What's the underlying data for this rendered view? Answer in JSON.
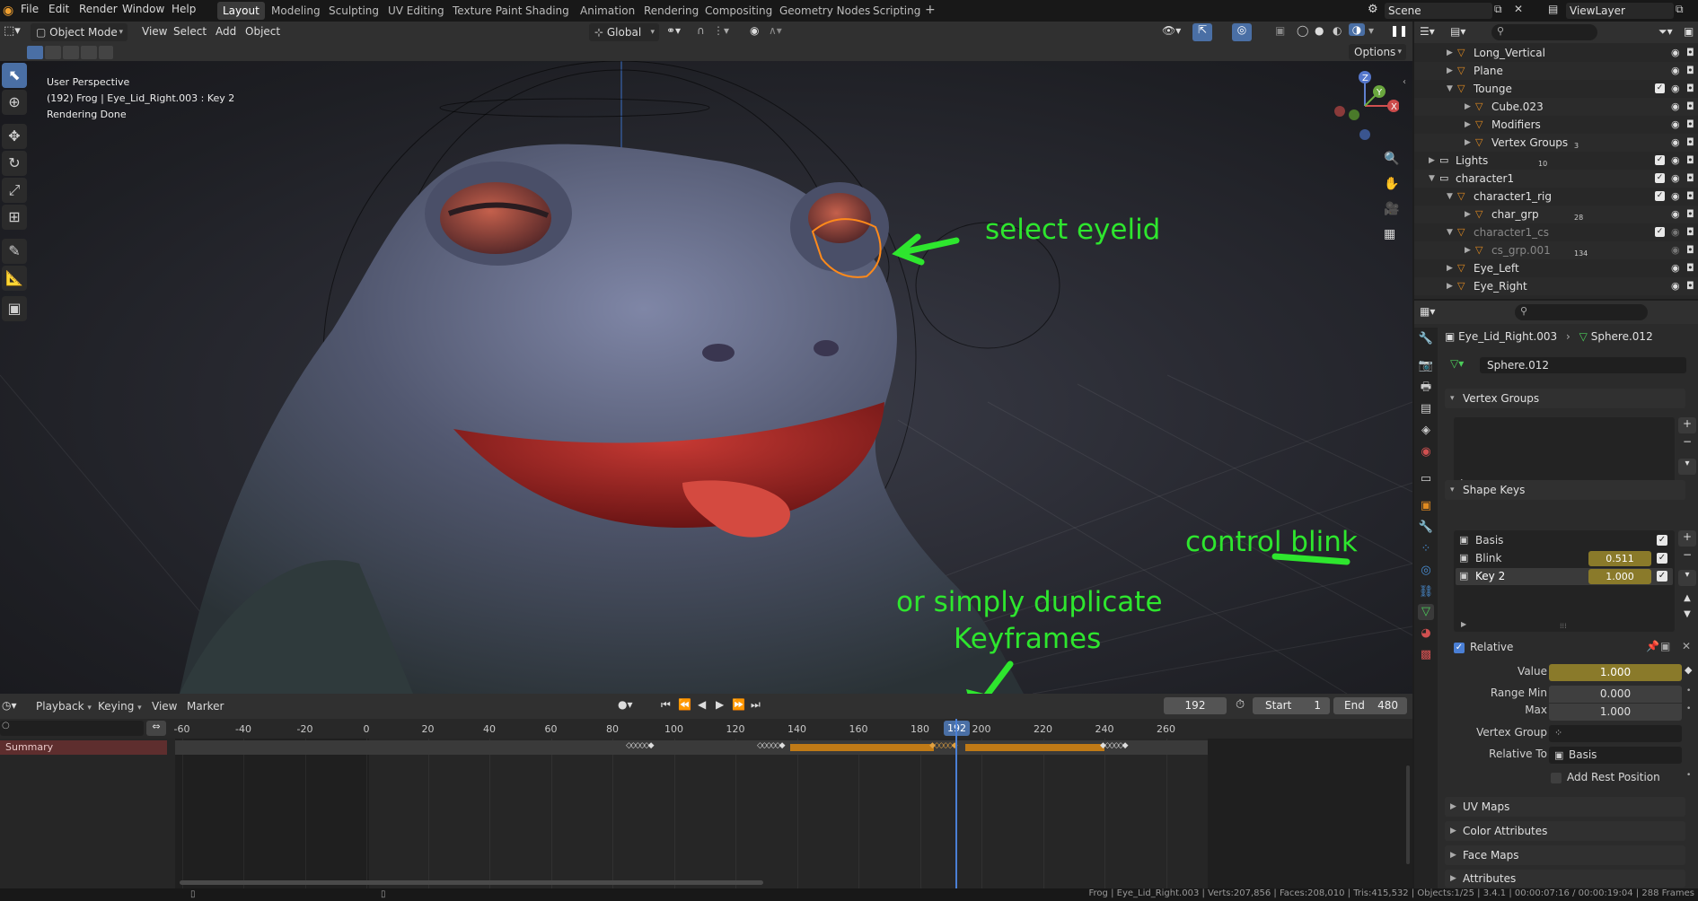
{
  "app": {
    "menus": [
      "File",
      "Edit",
      "Render",
      "Window",
      "Help"
    ],
    "workspaces": [
      "Layout",
      "Modeling",
      "Sculpting",
      "UV Editing",
      "Texture Paint",
      "Shading",
      "Animation",
      "Rendering",
      "Compositing",
      "Geometry Nodes",
      "Scripting"
    ],
    "active_workspace": "Layout",
    "scene": "Scene",
    "view_layer": "ViewLayer"
  },
  "viewport_header": {
    "mode": "Object Mode",
    "menus": [
      "View",
      "Select",
      "Add",
      "Object"
    ],
    "orientation": "Global",
    "options": "Options"
  },
  "viewport": {
    "perspective": "User Perspective",
    "object_info": "(192) Frog | Eye_Lid_Right.003 : Key 2",
    "status": "Rendering Done",
    "gizmo_axes": [
      "Z",
      "Y",
      "X"
    ]
  },
  "annotations": {
    "select_eyelid": "select eyelid",
    "control_blink": "control blink",
    "duplicate_line1": "or simply duplicate",
    "duplicate_line2": "Keyframes"
  },
  "timeline": {
    "menus": [
      "Playback",
      "Keying",
      "View",
      "Marker"
    ],
    "current_frame": "192",
    "start_label": "Start",
    "start": "1",
    "end_label": "End",
    "end": "480",
    "ticks": [
      "-60",
      "-40",
      "-20",
      "0",
      "20",
      "40",
      "60",
      "80",
      "100",
      "120",
      "140",
      "160",
      "180",
      "200",
      "220",
      "240",
      "260"
    ],
    "summary": "Summary"
  },
  "status_bar": {
    "text": "Frog | Eye_Lid_Right.003 | Verts:207,856 | Faces:208,010 | Tris:415,532 | Objects:1/25 | 3.4.1 | 00:00:07:16 / 00:00:19:04 | 288 Frames"
  },
  "outliner": {
    "rows": [
      {
        "label": "Long_Vertical",
        "indent": 1,
        "expanded": false
      },
      {
        "label": "Plane",
        "indent": 1,
        "expanded": false
      },
      {
        "label": "Tounge",
        "indent": 1,
        "expanded": true
      },
      {
        "label": "Cube.023",
        "indent": 2,
        "expanded": false
      },
      {
        "label": "Modifiers",
        "indent": 2,
        "expanded": false
      },
      {
        "label": "Vertex Groups",
        "indent": 2,
        "expanded": false,
        "badge": "3"
      },
      {
        "label": "Lights",
        "indent": 0,
        "expanded": false,
        "badge": "10"
      },
      {
        "label": "character1",
        "indent": 0,
        "expanded": true
      },
      {
        "label": "character1_rig",
        "indent": 1,
        "expanded": true
      },
      {
        "label": "char_grp",
        "indent": 2,
        "expanded": false,
        "badge": "28"
      },
      {
        "label": "character1_cs",
        "indent": 1,
        "expanded": true,
        "dim": true
      },
      {
        "label": "cs_grp.001",
        "indent": 2,
        "expanded": false,
        "dim": true,
        "badge": "134"
      },
      {
        "label": "Eye_Left",
        "indent": 1,
        "expanded": false
      },
      {
        "label": "Eye_Right",
        "indent": 1,
        "expanded": false
      }
    ]
  },
  "properties": {
    "breadcrumb_object": "Eye_Lid_Right.003",
    "breadcrumb_data": "Sphere.012",
    "mesh_name": "Sphere.012",
    "vertex_groups_title": "Vertex Groups",
    "shape_keys_title": "Shape Keys",
    "shape_keys": [
      {
        "name": "Basis",
        "value": ""
      },
      {
        "name": "Blink",
        "value": "0.511"
      },
      {
        "name": "Key 2",
        "value": "1.000"
      }
    ],
    "relative_label": "Relative",
    "value_label": "Value",
    "value": "1.000",
    "range_min_label": "Range Min",
    "range_min": "0.000",
    "max_label": "Max",
    "max": "1.000",
    "vertex_group_label": "Vertex Group",
    "relative_to_label": "Relative To",
    "relative_to": "Basis",
    "add_rest_label": "Add Rest Position",
    "collapsed_panels": [
      "UV Maps",
      "Color Attributes",
      "Face Maps",
      "Attributes"
    ]
  },
  "colors": {
    "accent_blue": "#4a6fa5",
    "keyframe_orange": "#c07a16",
    "annotation_green": "#2ee62e",
    "shape_value_gold": "#8a7a2a"
  }
}
